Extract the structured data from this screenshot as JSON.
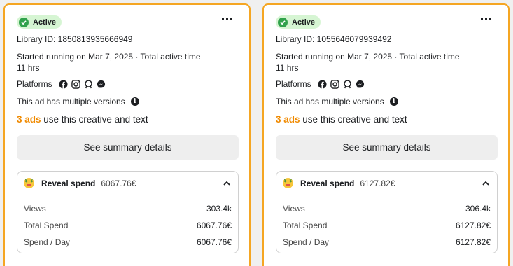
{
  "cards": [
    {
      "status": "Active",
      "library_id": "Library ID: 1850813935666949",
      "started_line1": "Started running on Mar 7, 2025 · Total active time",
      "started_line2": "11 hrs",
      "platforms_label": "Platforms",
      "platform_icons": [
        "facebook-icon",
        "instagram-icon",
        "audience-network-icon",
        "messenger-icon"
      ],
      "versions_text": "This ad has multiple versions",
      "ads_count": "3 ads",
      "ads_suffix": " use this creative and text",
      "summary_button": "See summary details",
      "reveal_label": "Reveal spend",
      "reveal_amount": "6067.76€",
      "metrics": [
        {
          "label": "Views",
          "value": "303.4k"
        },
        {
          "label": "Total Spend",
          "value": "6067.76€"
        },
        {
          "label": "Spend / Day",
          "value": "6067.76€"
        }
      ]
    },
    {
      "status": "Active",
      "library_id": "Library ID: 1055646079939492",
      "started_line1": "Started running on Mar 7, 2025 · Total active time",
      "started_line2": "11 hrs",
      "platforms_label": "Platforms",
      "platform_icons": [
        "facebook-icon",
        "instagram-icon",
        "audience-network-icon",
        "messenger-icon"
      ],
      "versions_text": "This ad has multiple versions",
      "ads_count": "3 ads",
      "ads_suffix": " use this creative and text",
      "summary_button": "See summary details",
      "reveal_label": "Reveal spend",
      "reveal_amount": "6127.82€",
      "metrics": [
        {
          "label": "Views",
          "value": "306.4k"
        },
        {
          "label": "Total Spend",
          "value": "6127.82€"
        },
        {
          "label": "Spend / Day",
          "value": "6127.82€"
        }
      ]
    }
  ],
  "colors": {
    "card_border": "#f5a623",
    "active_bg": "#d6f5d3",
    "active_check": "#31a24c",
    "ads_count": "#f08a00",
    "button_bg": "#eeeeee"
  }
}
